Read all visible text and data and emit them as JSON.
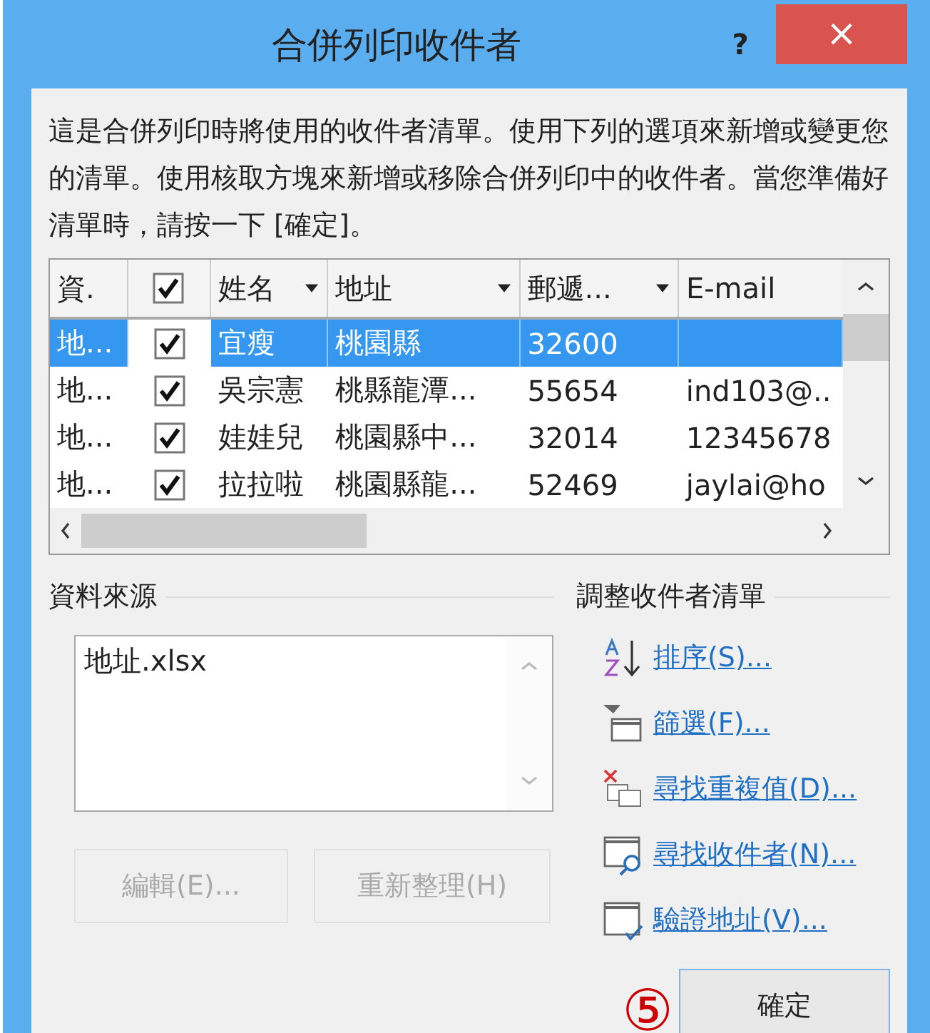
{
  "window": {
    "title": "合併列印收件者",
    "help": "?",
    "close": "×"
  },
  "description": "這是合併列印時將使用的收件者清單。使用下列的選項來新增或變更您的清單。使用核取方塊來新增或移除合併列印中的收件者。當您準備好清單時，請按一下 [確定]。",
  "table": {
    "all_checked": true,
    "columns": [
      {
        "label": "資.",
        "dropdown": false
      },
      {
        "label": "姓名",
        "dropdown": true
      },
      {
        "label": "地址",
        "dropdown": true
      },
      {
        "label": "郵遞...",
        "dropdown": true
      },
      {
        "label": "E-mail",
        "dropdown": false
      }
    ],
    "rows": [
      {
        "source": "地...",
        "checked": true,
        "name": "宜瘦",
        "address": "桃園縣",
        "zip": "32600",
        "selected": true
      },
      {
        "source": "地...",
        "checked": true,
        "name": "吳宗憲",
        "address": "桃縣龍潭...",
        "zip": "55654",
        "email": "ind103@..",
        "selected": false
      },
      {
        "source": "地...",
        "checked": true,
        "name": "娃娃兒",
        "address": "桃園縣中...",
        "zip": "32014",
        "email": "12345678",
        "selected": false
      },
      {
        "source": "地...",
        "checked": true,
        "name": "拉拉啦",
        "address": "桃園縣龍...",
        "zip": "52469",
        "email": "jaylai@ho",
        "selected": false
      }
    ]
  },
  "data_source": {
    "label": "資料來源",
    "items": [
      "地址.xlsx"
    ],
    "buttons": [
      {
        "label": "編輯(E)...",
        "disabled": true
      },
      {
        "label": "重新整理(H)",
        "disabled": true
      }
    ]
  },
  "refine": {
    "label": "調整收件者清單",
    "links": [
      {
        "kind": "sort",
        "label": "排序(S)..."
      },
      {
        "kind": "filter",
        "label": "篩選(F)..."
      },
      {
        "kind": "duplicates",
        "label": "尋找重複值(D)..."
      },
      {
        "kind": "find",
        "label": "尋找收件者(N)..."
      },
      {
        "kind": "validate",
        "label": "驗證地址(V)..."
      }
    ]
  },
  "ok_button": "確定",
  "annotation": "⑤"
}
